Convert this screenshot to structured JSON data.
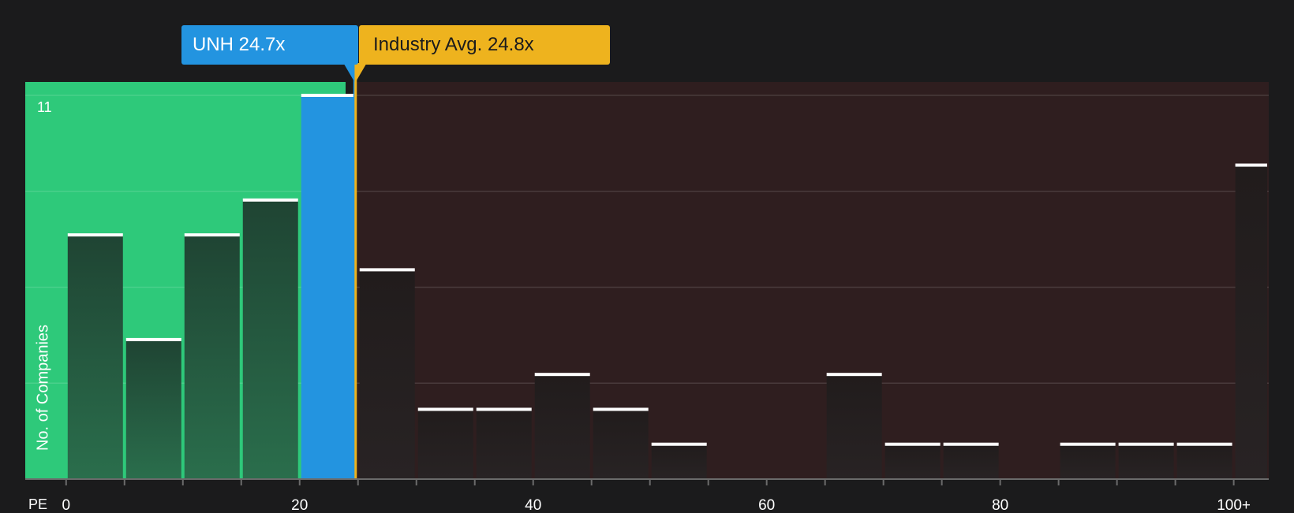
{
  "header": {
    "company_label": "UNH 24.7x",
    "industry_label": "Industry Avg. 24.8x"
  },
  "colors": {
    "background": "#1b1b1c",
    "green_zone": "#2ec97a",
    "red_zone": "#2f1e1f",
    "company": "#2394e0",
    "industry": "#eeb31e",
    "bar_green": "#235b40",
    "bar_dark": "#241f20"
  },
  "chart_data": {
    "type": "bar",
    "title": "",
    "xlabel": "PE",
    "ylabel": "No. of Companies",
    "y_max_label": "11",
    "ylim": [
      0,
      11
    ],
    "xlim": [
      -3.5,
      103
    ],
    "bin_width": 5,
    "x_ticks": [
      0,
      20,
      40,
      60,
      80,
      "100+"
    ],
    "bins": [
      {
        "x_start": 0,
        "value": 7
      },
      {
        "x_start": 5,
        "value": 4
      },
      {
        "x_start": 10,
        "value": 7
      },
      {
        "x_start": 15,
        "value": 8
      },
      {
        "x_start": 20,
        "value": 11,
        "highlight": true
      },
      {
        "x_start": 25,
        "value": 6
      },
      {
        "x_start": 30,
        "value": 2
      },
      {
        "x_start": 35,
        "value": 2
      },
      {
        "x_start": 40,
        "value": 3
      },
      {
        "x_start": 45,
        "value": 2
      },
      {
        "x_start": 50,
        "value": 1
      },
      {
        "x_start": 55,
        "value": 0
      },
      {
        "x_start": 60,
        "value": 0
      },
      {
        "x_start": 65,
        "value": 3
      },
      {
        "x_start": 70,
        "value": 1
      },
      {
        "x_start": 75,
        "value": 1
      },
      {
        "x_start": 80,
        "value": 0
      },
      {
        "x_start": 85,
        "value": 1
      },
      {
        "x_start": 90,
        "value": 1
      },
      {
        "x_start": 95,
        "value": 1
      },
      {
        "x_start": 100,
        "value": 9,
        "overflow": true
      }
    ],
    "company_value": 24.7,
    "industry_value": 24.8,
    "grid": true
  }
}
